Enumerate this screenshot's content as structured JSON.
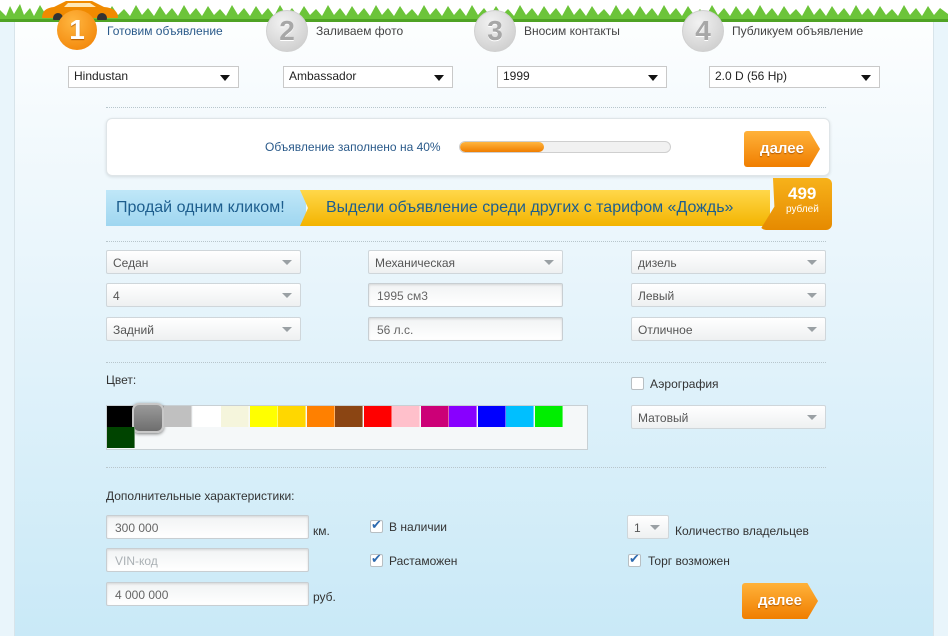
{
  "steps": [
    {
      "number": "1",
      "label": "Готовим объявление",
      "active": true
    },
    {
      "number": "2",
      "label": "Заливаем фото",
      "active": false
    },
    {
      "number": "3",
      "label": "Вносим контакты",
      "active": false
    },
    {
      "number": "4",
      "label": "Публикуем объявление",
      "active": false
    }
  ],
  "vehicle": {
    "make": "Hindustan",
    "model": "Ambassador",
    "year": "1999",
    "engine": "2.0 D (56 Hp)"
  },
  "progress": {
    "text": "Объявление заполнено на 40%",
    "percent": 40,
    "next_label": "далее"
  },
  "banner": {
    "left_text": "Продай одним кликом!",
    "right_text": "Выдели объявление среди других с тарифом «Дождь»",
    "price": "499",
    "currency": "рублей"
  },
  "specs": {
    "body": "Седан",
    "transmission": "Механическая",
    "fuel": "дизель",
    "doors": "4",
    "volume": "1995 см3",
    "steering": "Левый",
    "drive": "Задний",
    "power": "56 л.с.",
    "condition": "Отличное"
  },
  "color": {
    "label": "Цвет:",
    "swatches": [
      "#000000",
      "#7a7a7a",
      "#c0c0c0",
      "#ffffff",
      "#f5f5dc",
      "#ffff00",
      "#ffd700",
      "#ff8000",
      "#8b4513",
      "#ff0000",
      "#ffc0cb",
      "#cc0077",
      "#8800ff",
      "#0000ff",
      "#00bfff",
      "#00ee00",
      "#004400"
    ],
    "selected_index": 1,
    "airbrush_label": "Аэрография",
    "airbrush_checked": false,
    "finish": "Матовый"
  },
  "extra": {
    "title": "Дополнительные характеристики:",
    "mileage": "300 000",
    "mileage_unit": "км.",
    "vin_placeholder": "VIN-код",
    "price": "4 000 000",
    "price_unit": "руб.",
    "in_stock_label": "В наличии",
    "in_stock_checked": true,
    "customs_label": "Растаможен",
    "customs_checked": true,
    "owners_value": "1",
    "owners_label": "Количество владельцев",
    "bargain_label": "Торг возможен",
    "bargain_checked": true,
    "next_label": "далее"
  }
}
